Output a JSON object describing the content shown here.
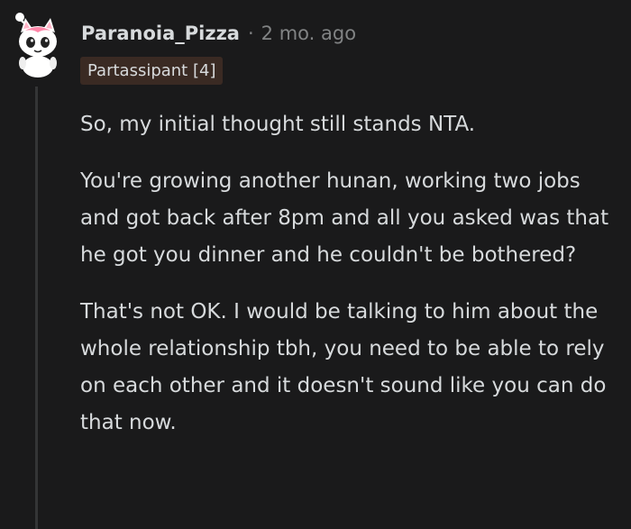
{
  "comment": {
    "author": "Paranoia_Pizza",
    "separator": "·",
    "age": "2 mo. ago",
    "flair": "Partassipant [4]",
    "paragraphs": [
      "So, my initial thought still stands NTA.",
      "You're growing another hunan, working two jobs and got back after 8pm and all you asked was that he got you dinner and he couldn't be bothered?",
      "That's not OK. I would be talking to him about the whole relationship tbh, you need to be able to rely on each other and it doesn't sound like you can do that now."
    ]
  },
  "colors": {
    "background": "#1a1a1b",
    "text": "#d7dadc",
    "muted": "#818384",
    "flair_bg": "#3a2a23",
    "thread_line": "#343536"
  },
  "icons": {
    "avatar": "snoo-avatar-icon"
  }
}
